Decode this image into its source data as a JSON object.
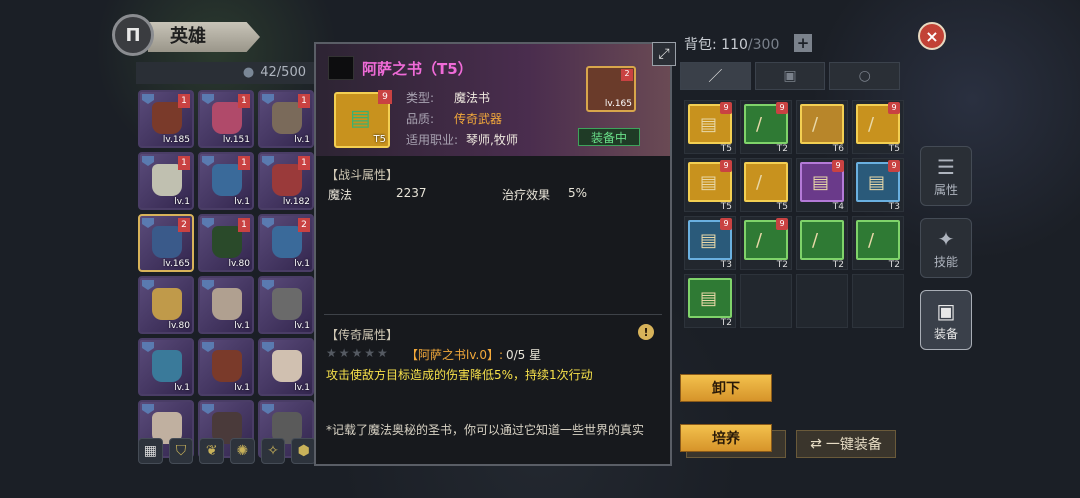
{
  "header": {
    "emblem": "Π",
    "title": "英雄",
    "hero_count": "42/500",
    "equip_tab_hint": "装备"
  },
  "heroes": [
    {
      "lv": "lv.185",
      "rank": "1",
      "color": "#7a3a2a"
    },
    {
      "lv": "lv.151",
      "rank": "1",
      "color": "#b04a6a"
    },
    {
      "lv": "lv.1",
      "rank": "1",
      "color": "#7a6a5a"
    },
    {
      "lv": "lv.1",
      "rank": "1",
      "color": "#c0c0b0"
    },
    {
      "lv": "lv.1",
      "rank": "1",
      "color": "#3a6a9a"
    },
    {
      "lv": "lv.182",
      "rank": "1",
      "color": "#9a3a3a"
    },
    {
      "lv": "lv.165",
      "rank": "2",
      "color": "#3a5a8a"
    },
    {
      "lv": "lv.80",
      "rank": "1",
      "color": "#2a4a2a"
    },
    {
      "lv": "lv.1",
      "rank": "2",
      "color": "#3a6a9a"
    },
    {
      "lv": "lv.80",
      "rank": "",
      "color": "#c09a4a"
    },
    {
      "lv": "lv.1",
      "rank": "",
      "color": "#b0a090"
    },
    {
      "lv": "lv.1",
      "rank": "",
      "color": "#6a6a6a"
    },
    {
      "lv": "lv.1",
      "rank": "",
      "color": "#3a7a9a"
    },
    {
      "lv": "lv.1",
      "rank": "",
      "color": "#7a3a2a"
    },
    {
      "lv": "lv.1",
      "rank": "",
      "color": "#d0c0b0"
    },
    {
      "lv": "",
      "rank": "",
      "color": "#c0b0a0"
    },
    {
      "lv": "",
      "rank": "",
      "color": "#4a3a3a"
    },
    {
      "lv": "",
      "rank": "",
      "color": "#5a5a5a"
    }
  ],
  "filters": [
    "grid-icon",
    "shield-icon",
    "leaf-icon",
    "gear-icon",
    "compass-icon",
    "crest-icon"
  ],
  "item": {
    "title": "阿萨之书（T5）",
    "count": "9",
    "tier": "T5",
    "type_label": "类型:",
    "type_value": "魔法书",
    "quality_label": "品质:",
    "quality_value": "传奇武器",
    "class_label": "适用职业:",
    "class_value": "琴师,牧师",
    "equipped_hero_rank": "2",
    "equipped_hero_lv": "lv.165",
    "equip_status": "装备中",
    "combat_title": "【战斗属性】",
    "stat1_name": "魔法",
    "stat1_value": "2237",
    "stat2_name": "治疗效果",
    "stat2_value": "5%",
    "legend_title": "【传奇属性】",
    "stars": "★★★★★",
    "legend_name": "【阿萨之书lv.0】:",
    "legend_progress": "0/5 星",
    "legend_desc": "攻击使敌方目标造成的伤害降低5%，持续1次行动",
    "flavor": "*记载了魔法奥秘的圣书，你可以通过它知道一些世界的真实"
  },
  "bag": {
    "label": "背包:",
    "used": "110",
    "capacity": "/300",
    "plus": "+",
    "tabs": [
      "sword-icon",
      "armor-icon",
      "ring-icon"
    ],
    "items": [
      {
        "tier": "T5",
        "cnt": "9",
        "border": "#f3cf52",
        "bg": "#c8921e",
        "glyph": "▤"
      },
      {
        "tier": "T2",
        "cnt": "9",
        "border": "#7fd36a",
        "bg": "#2f7a34",
        "glyph": "/"
      },
      {
        "tier": "T6",
        "cnt": "",
        "border": "#f3cf52",
        "bg": "#b8862a",
        "glyph": "/"
      },
      {
        "tier": "T5",
        "cnt": "9",
        "border": "#f3cf52",
        "bg": "#c8921e",
        "glyph": "/"
      },
      {
        "tier": "T5",
        "cnt": "9",
        "border": "#f3cf52",
        "bg": "#c8921e",
        "glyph": "▤"
      },
      {
        "tier": "T5",
        "cnt": "",
        "border": "#f3cf52",
        "bg": "#c8921e",
        "glyph": "/"
      },
      {
        "tier": "T4",
        "cnt": "9",
        "border": "#b47ad8",
        "bg": "#6a3a8a",
        "glyph": "▤"
      },
      {
        "tier": "T3",
        "cnt": "9",
        "border": "#6ab0e0",
        "bg": "#2a5a7a",
        "glyph": "▤"
      },
      {
        "tier": "T3",
        "cnt": "9",
        "border": "#6ab0e0",
        "bg": "#2a5a7a",
        "glyph": "▤"
      },
      {
        "tier": "T2",
        "cnt": "9",
        "border": "#7fd36a",
        "bg": "#2f7a34",
        "glyph": "/"
      },
      {
        "tier": "T2",
        "cnt": "",
        "border": "#7fd36a",
        "bg": "#2f7a34",
        "glyph": "/"
      },
      {
        "tier": "T2",
        "cnt": "",
        "border": "#7fd36a",
        "bg": "#2f7a34",
        "glyph": "/"
      },
      {
        "tier": "T2",
        "cnt": "",
        "border": "#7fd36a",
        "bg": "#2f7a34",
        "glyph": "▤"
      }
    ],
    "unequip": "卸下",
    "train": "培养",
    "auto_equip": "一键装备"
  },
  "side_tabs": [
    {
      "icon": "list-icon",
      "label": "属性"
    },
    {
      "icon": "skill-icon",
      "label": "技能"
    },
    {
      "icon": "armor-icon",
      "label": "装备"
    }
  ],
  "close": "×"
}
